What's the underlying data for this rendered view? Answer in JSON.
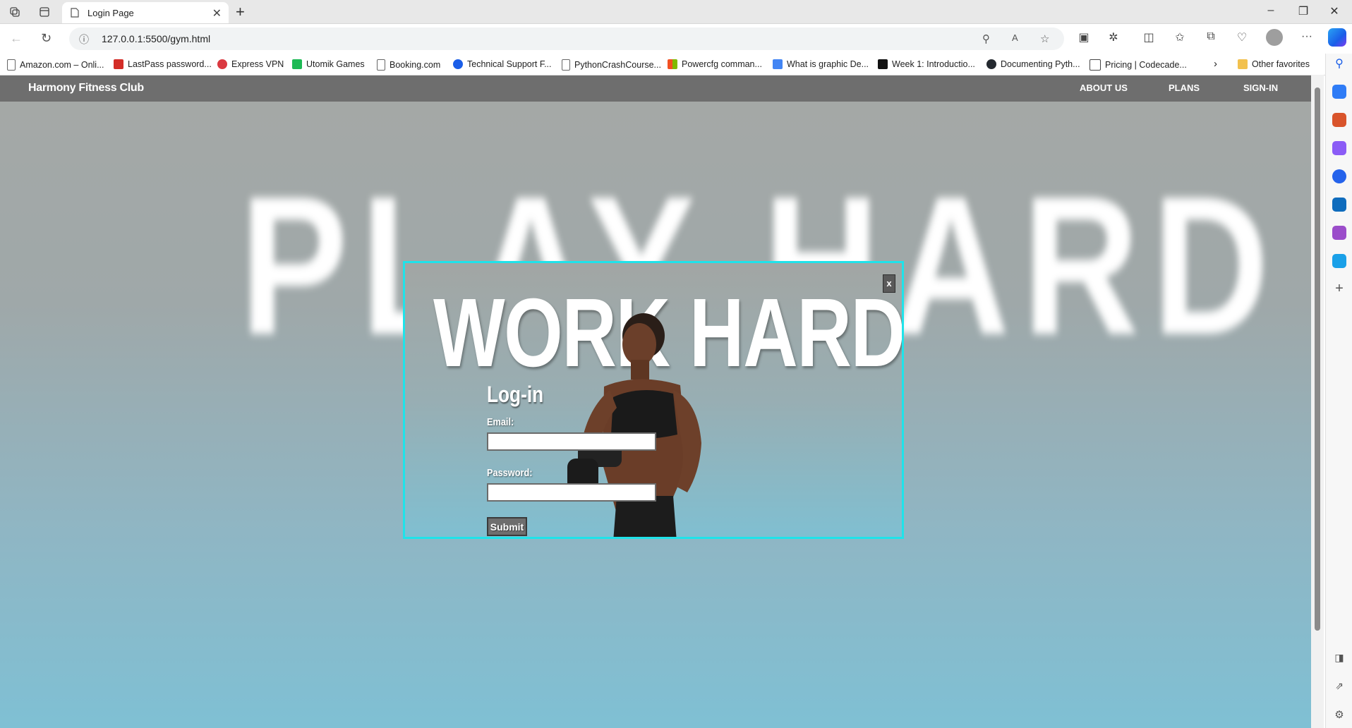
{
  "browser": {
    "tab_title": "Login Page",
    "url": "127.0.0.1:5500/gym.html",
    "bookmarks": [
      {
        "label": "Amazon.com – Onli...",
        "icon": "page-icon"
      },
      {
        "label": "LastPass password...",
        "icon": "lastpass-icon"
      },
      {
        "label": "Express VPN",
        "icon": "expressvpn-icon"
      },
      {
        "label": "Utomik Games",
        "icon": "utomik-icon"
      },
      {
        "label": "Booking.com",
        "icon": "page-icon"
      },
      {
        "label": "Technical Support F...",
        "icon": "globe-icon"
      },
      {
        "label": "PythonCrashCourse...",
        "icon": "page-icon"
      },
      {
        "label": "Powercfg comman...",
        "icon": "microsoft-icon"
      },
      {
        "label": "What is graphic De...",
        "icon": "docs-icon"
      },
      {
        "label": "Week 1: Introductio...",
        "icon": "d2l-icon"
      },
      {
        "label": "Documenting Pyth...",
        "icon": "github-icon"
      },
      {
        "label": "Pricing | Codecade...",
        "icon": "codecademy-icon"
      }
    ],
    "other_favorites": "Other favorites"
  },
  "site": {
    "brand": "Harmony Fitness Club",
    "nav": {
      "about": "ABOUT US",
      "plans": "PLANS",
      "signin": "SIGN-IN"
    },
    "background_text": "PLAY HARD"
  },
  "modal": {
    "close_label": "x",
    "headline": "WORK HARD",
    "login_title": "Log-in",
    "email_label": "Email:",
    "email_value": "",
    "password_label": "Password:",
    "password_value": "",
    "submit_label": "Submit"
  },
  "colors": {
    "modal_border": "#1fe3ea",
    "site_nav_bg": "#6e6e6e",
    "background_top": "#a5a8a6",
    "background_bottom": "#7fc0d4"
  }
}
